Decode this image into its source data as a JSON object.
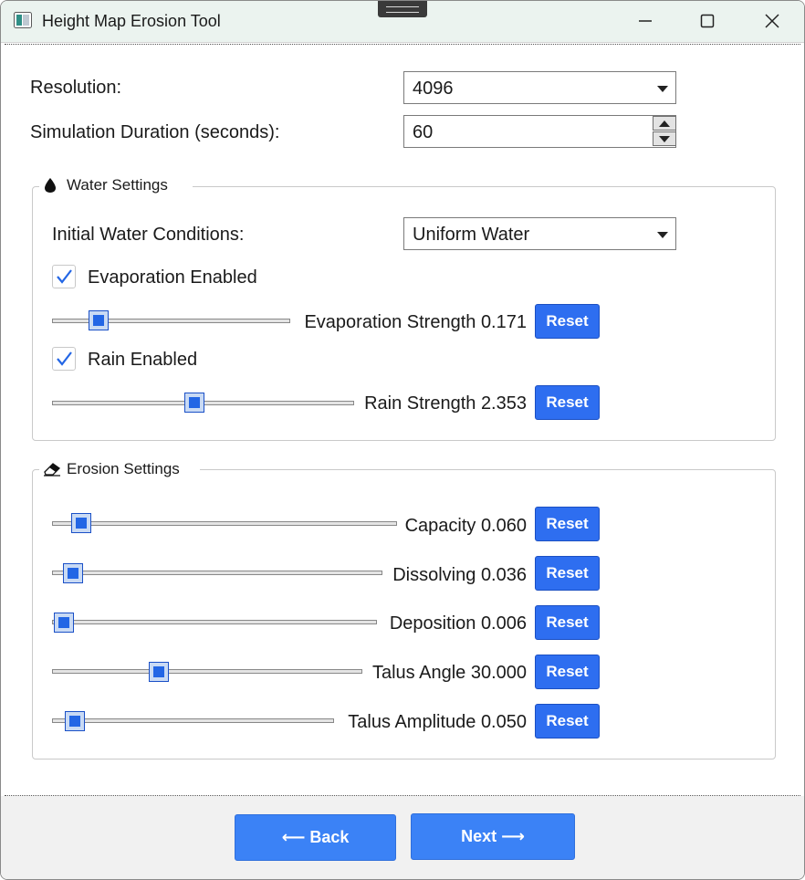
{
  "window": {
    "title": "Height Map Erosion Tool",
    "controls": [
      "minimize-icon",
      "maximize-icon",
      "close-icon"
    ]
  },
  "general": {
    "resolution": {
      "label": "Resolution:",
      "value": "4096"
    },
    "duration": {
      "label": "Simulation Duration (seconds):",
      "value": "60"
    }
  },
  "water": {
    "title": "Water Settings",
    "icon": "water-drop-icon",
    "initial": {
      "label": "Initial Water Conditions:",
      "value": "Uniform Water"
    },
    "evaporation_enabled": {
      "label": "Evaporation Enabled",
      "checked": true
    },
    "evaporation_strength": {
      "label": "Evaporation Strength",
      "value": "0.171",
      "position": 0.2,
      "reset": "Reset"
    },
    "rain_enabled": {
      "label": "Rain Enabled",
      "checked": true
    },
    "rain_strength": {
      "label": "Rain Strength",
      "value": "2.353",
      "position": 0.47,
      "reset": "Reset"
    }
  },
  "erosion": {
    "title": "Erosion Settings",
    "icon": "eraser-icon",
    "sliders": [
      {
        "label": "Capacity",
        "value": "0.060",
        "position": 0.08,
        "reset": "Reset"
      },
      {
        "label": "Dissolving",
        "value": "0.036",
        "position": 0.06,
        "reset": "Reset"
      },
      {
        "label": "Deposition",
        "value": "0.006",
        "position": 0.01,
        "reset": "Reset"
      },
      {
        "label": "Talus Angle",
        "value": "30.000",
        "position": 0.34,
        "reset": "Reset"
      },
      {
        "label": "Talus Amplitude",
        "value": "0.050",
        "position": 0.07,
        "reset": "Reset"
      }
    ]
  },
  "footer": {
    "back": "⟵ Back",
    "next": "Next ⟶"
  },
  "colors": {
    "accent": "#2e6ef0",
    "titlebar": "#ebf3ef",
    "footer": "#f1f1f1",
    "check": "#2366e5"
  }
}
